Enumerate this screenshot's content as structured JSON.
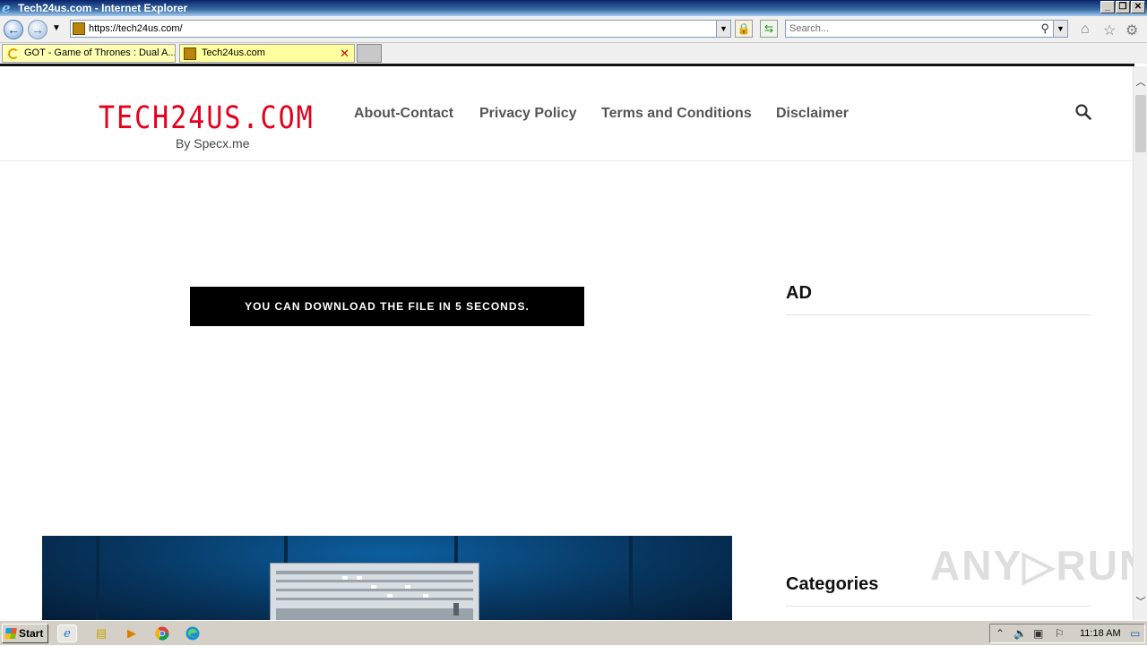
{
  "window": {
    "title": "Tech24us.com - Internet Explorer"
  },
  "browser": {
    "url": "https://tech24us.com/",
    "search_placeholder": "Search...",
    "tabs": [
      {
        "label": "GOT - Game of Thrones : Dual A...",
        "loading": true
      },
      {
        "label": "Tech24us.com",
        "active": true
      }
    ]
  },
  "site": {
    "logo": "TECH24US.COM",
    "tagline": "By Specx.me",
    "nav": [
      "About-Contact",
      "Privacy Policy",
      "Terms and Conditions",
      "Disclaimer"
    ],
    "notice": "YOU CAN DOWNLOAD THE FILE IN 5 SECONDS.",
    "sidebar": {
      "ad_heading": "AD",
      "categories_heading": "Categories"
    },
    "watermark": "ANY▷RUN",
    "colors": {
      "logo": "#e3001b",
      "notice_bg": "#000000"
    }
  },
  "taskbar": {
    "start_label": "Start",
    "clock": "11:18 AM"
  }
}
